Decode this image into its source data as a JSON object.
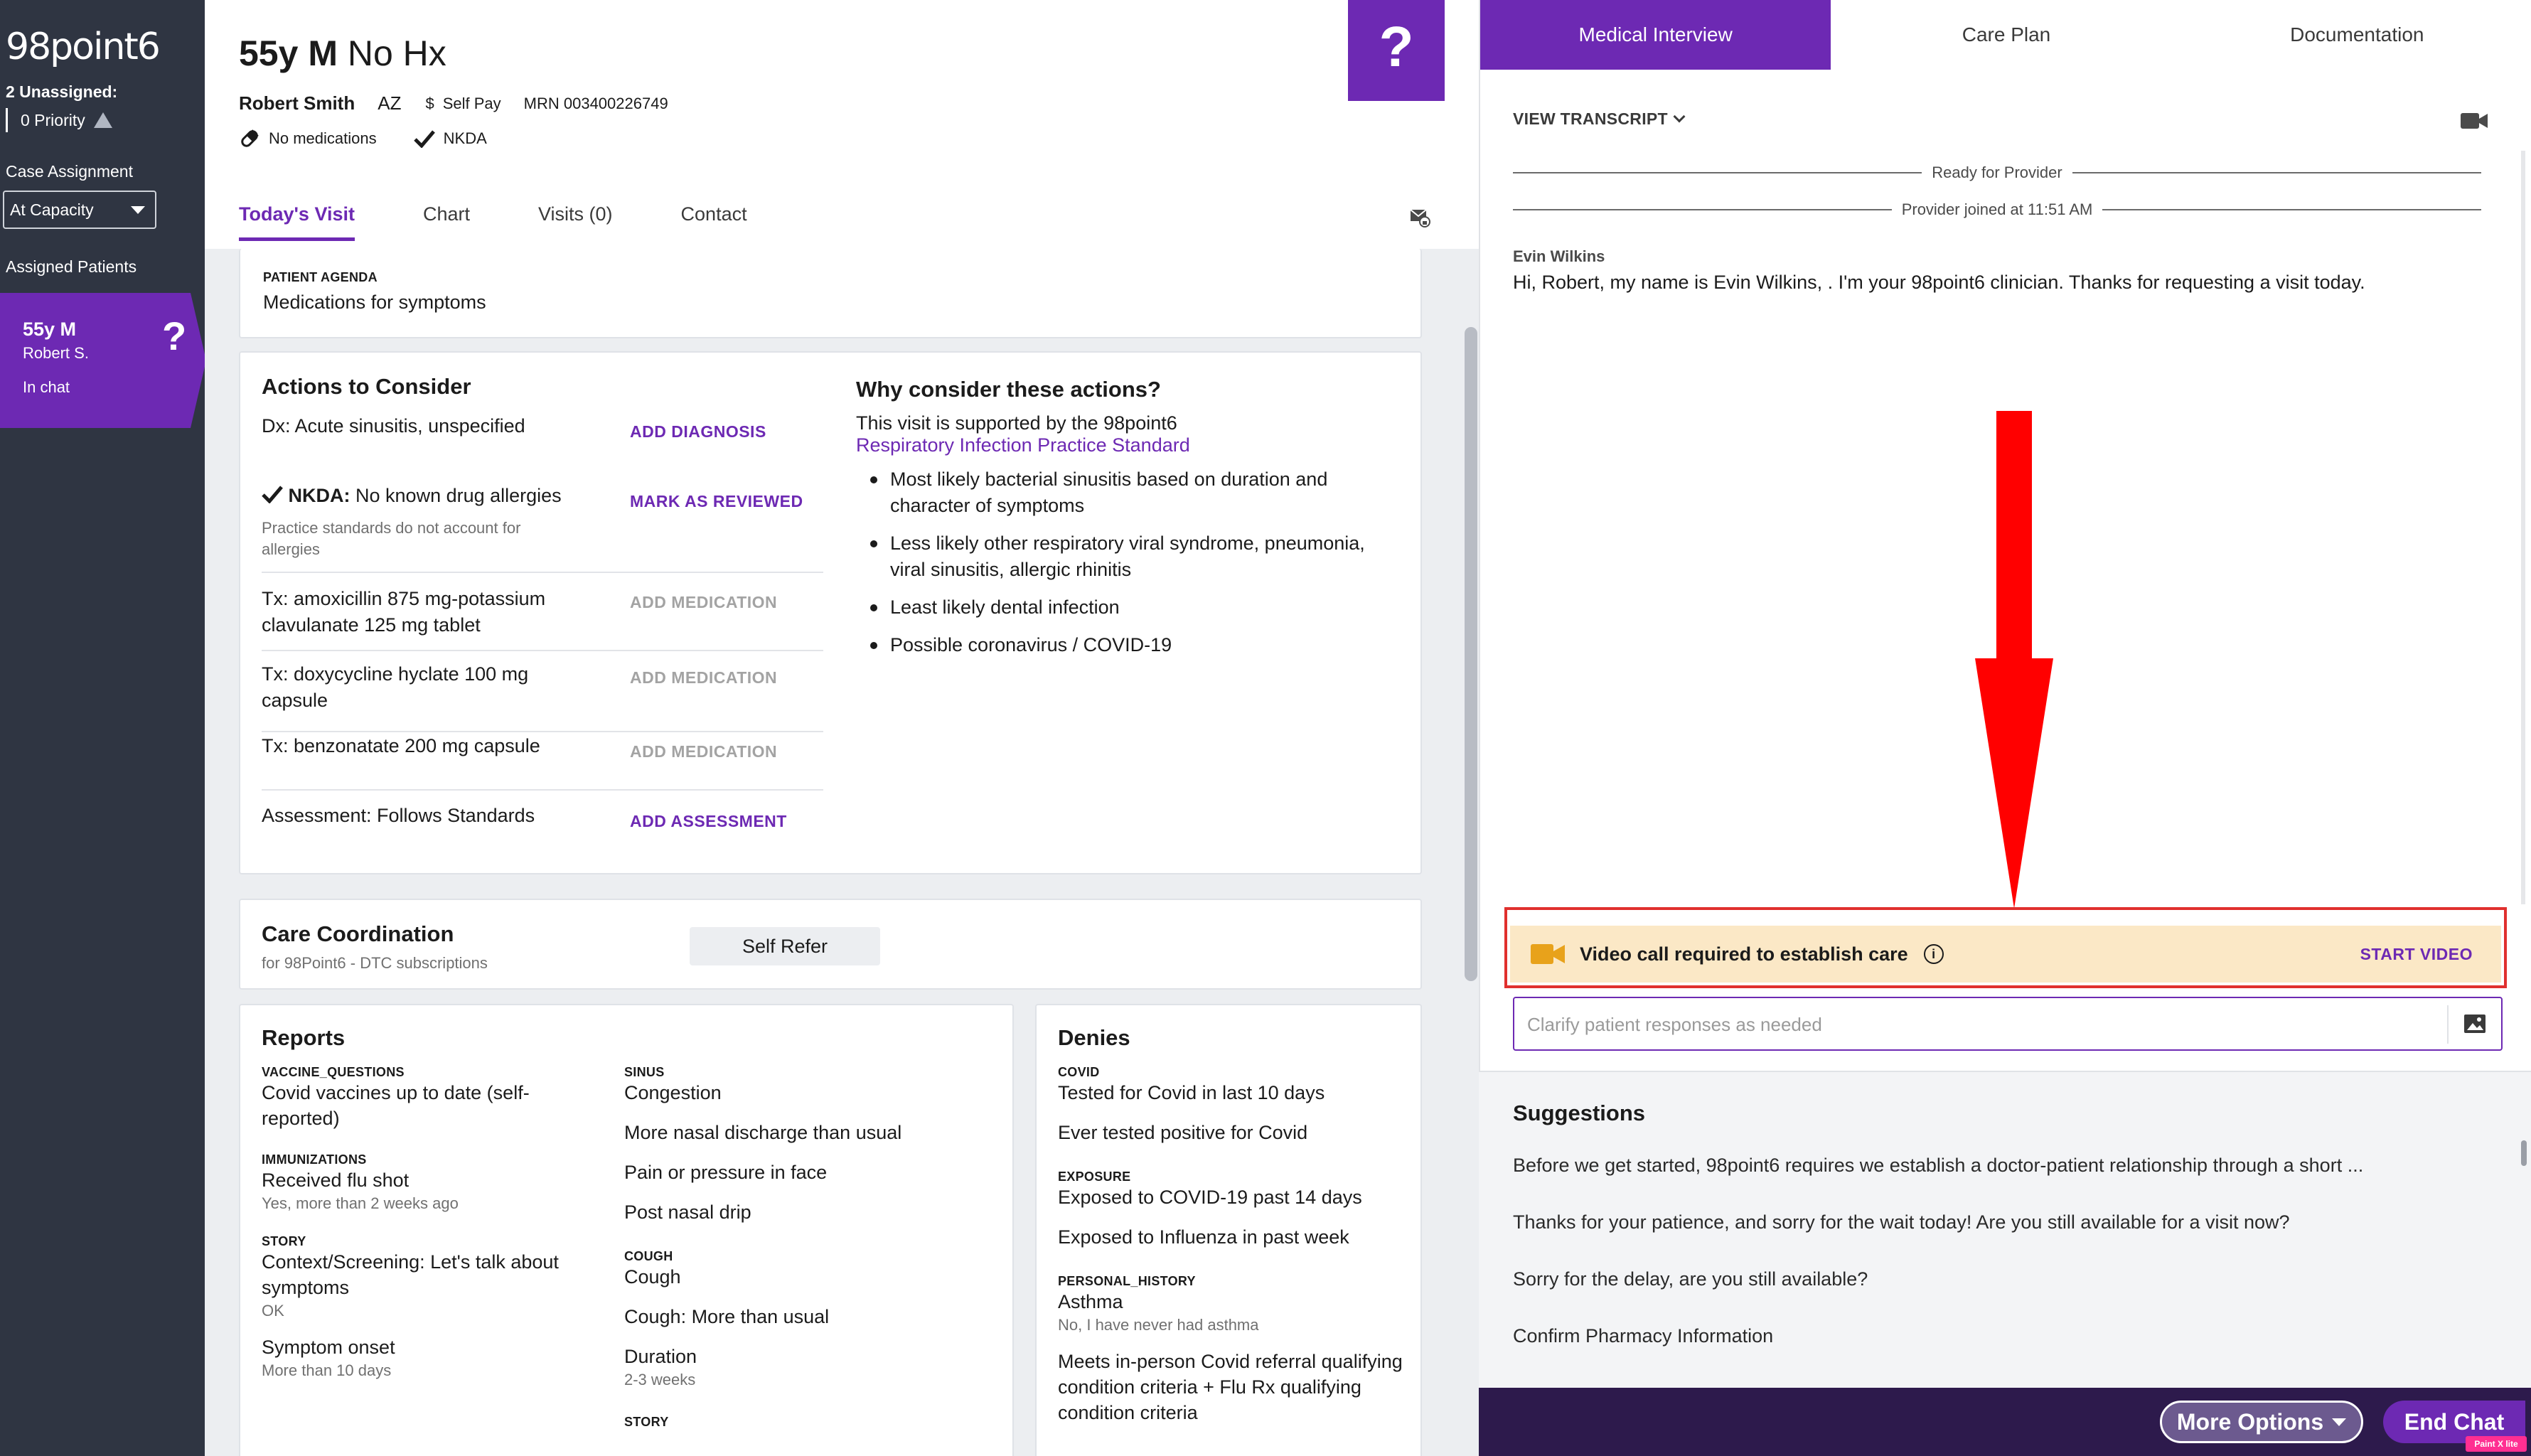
{
  "sidebar": {
    "logo": "98point6",
    "unassigned": "2 Unassigned:",
    "priority": "0 Priority",
    "case_assignment_label": "Case Assignment",
    "case_assignment_value": "At Capacity",
    "assigned_patients_label": "Assigned Patients",
    "patient": {
      "title": "55y M",
      "name": "Robert S.",
      "status": "In chat",
      "badge": "?"
    }
  },
  "patient_header": {
    "title_bold": "55y M",
    "title_rest": "No Hx",
    "name": "Robert Smith",
    "state": "AZ",
    "pay_symbol": "$",
    "pay": "Self Pay",
    "mrn": "MRN 003400226749",
    "medications": "No medications",
    "allergies": "NKDA",
    "badge": "?"
  },
  "tabs": [
    "Today's Visit",
    "Chart",
    "Visits (0)",
    "Contact"
  ],
  "agenda": {
    "label": "PATIENT AGENDA",
    "value": "Medications for symptoms"
  },
  "actions": {
    "title": "Actions to Consider",
    "rows": [
      {
        "text": "Dx: Acute sinusitis, unspecified",
        "action": "ADD DIAGNOSIS"
      },
      {
        "text_bold": "NKDA:",
        "text": " No known drug allergies",
        "note": "Practice standards do not account for allergies",
        "action": "MARK AS REVIEWED"
      },
      {
        "text": "Tx: amoxicillin 875 mg-potassium clavulanate 125 mg tablet",
        "action": "ADD MEDICATION"
      },
      {
        "text": "Tx: doxycycline hyclate 100 mg capsule",
        "action": "ADD MEDICATION"
      },
      {
        "text": "Tx: benzonatate 200 mg capsule",
        "action": "ADD MEDICATION"
      },
      {
        "text": "Assessment: Follows Standards",
        "action": "ADD ASSESSMENT"
      }
    ],
    "why_title": "Why consider these actions?",
    "why_intro": "This visit is supported by the 98point6",
    "why_link": "Respiratory Infection Practice Standard",
    "why_items": [
      "Most likely bacterial sinusitis based on duration and character of symptoms",
      "Less likely other respiratory viral syndrome, pneumonia, viral sinusitis, allergic rhinitis",
      "Least likely dental infection",
      "Possible coronavirus / COVID-19"
    ]
  },
  "care_coordination": {
    "title": "Care Coordination",
    "subtitle": "for 98Point6 - DTC subscriptions",
    "button": "Self Refer"
  },
  "reports": {
    "title": "Reports",
    "vaccine_label": "VACCINE_QUESTIONS",
    "vaccine_value": "Covid vaccines up to date (self-reported)",
    "immun_label": "IMMUNIZATIONS",
    "immun_value": "Received flu shot",
    "immun_sub": "Yes, more than 2 weeks ago",
    "story_label": "STORY",
    "story_value": "Context/Screening: Let's talk about symptoms",
    "story_sub": "OK",
    "onset_value": "Symptom onset",
    "onset_sub": "More than 10 days",
    "sinus_label": "SINUS",
    "sinus_items": [
      "Congestion",
      "More nasal discharge than usual",
      "Pain or pressure in face",
      "Post nasal drip"
    ],
    "cough_label": "COUGH",
    "cough_items": [
      "Cough",
      "Cough: More than usual"
    ],
    "duration_value": "Duration",
    "duration_sub": "2-3 weeks",
    "story2_label": "STORY"
  },
  "denies": {
    "title": "Denies",
    "covid_label": "COVID",
    "covid_items": [
      "Tested for Covid in last 10 days",
      "Ever tested positive for Covid"
    ],
    "exposure_label": "EXPOSURE",
    "exposure_items": [
      "Exposed to COVID-19 past 14 days",
      "Exposed to Influenza in past week"
    ],
    "history_label": "PERSONAL_HISTORY",
    "history_value": "Asthma",
    "history_sub": "No, I have never had asthma",
    "referral": "Meets in-person Covid referral qualifying condition criteria + Flu Rx qualifying condition criteria"
  },
  "right_panel": {
    "tabs": [
      "Medical Interview",
      "Care Plan",
      "Documentation"
    ],
    "view_transcript": "VIEW TRANSCRIPT",
    "ready": "Ready for Provider",
    "joined": "Provider joined at 11:51 AM",
    "sender": "Evin Wilkins",
    "message": "Hi, Robert, my name is Evin Wilkins, . I'm your 98point6 clinician. Thanks for requesting a visit today.",
    "banner_text": "Video call required to establish care",
    "banner_info": "i",
    "banner_action": "START VIDEO",
    "input_placeholder": "Clarify patient responses as needed",
    "suggestions_title": "Suggestions",
    "suggestions": [
      "Before we get started, 98point6 requires we establish a doctor-patient relationship through a short ...",
      "Thanks for your patience, and sorry for the wait today! Are you still available for a visit now?",
      "Sorry for the delay, are you still available?",
      "Confirm Pharmacy Information"
    ],
    "more_options": "More Options",
    "end_chat": "End Chat",
    "watermark": "Paint X lite"
  },
  "colors": {
    "brand_purple": "#6d29b3",
    "sidebar": "#2f3542",
    "banner": "#fbe8c6",
    "annotation_red": "#ff0000"
  }
}
